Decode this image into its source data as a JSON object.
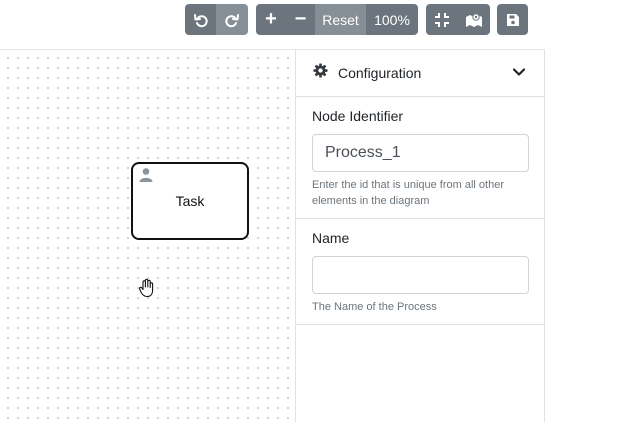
{
  "toolbar": {
    "undo_icon": "undo-icon",
    "redo_icon": "redo-icon",
    "zoom_in_label": "+",
    "zoom_out_label": "−",
    "reset_label": "Reset",
    "zoom_level": "100%",
    "fit_icon": "compress-icon",
    "map_icon": "map-icon",
    "save_icon": "save-icon"
  },
  "canvas": {
    "task_label": "Task",
    "task_icon": "user-icon",
    "cursor_icon": "hand-icon"
  },
  "panel": {
    "title": "Configuration",
    "title_icon": "gear-icon",
    "collapse_icon": "chevron-down-icon",
    "fields": [
      {
        "label": "Node Identifier",
        "value": "Process_1",
        "help": "Enter the id that is unique from all other elements in the diagram"
      },
      {
        "label": "Name",
        "value": "",
        "help": "The Name of the Process"
      }
    ]
  },
  "colors": {
    "button_dark": "#6c757d",
    "button_light": "#868e96",
    "border": "#dee2e6",
    "help_text": "#6c757d"
  }
}
